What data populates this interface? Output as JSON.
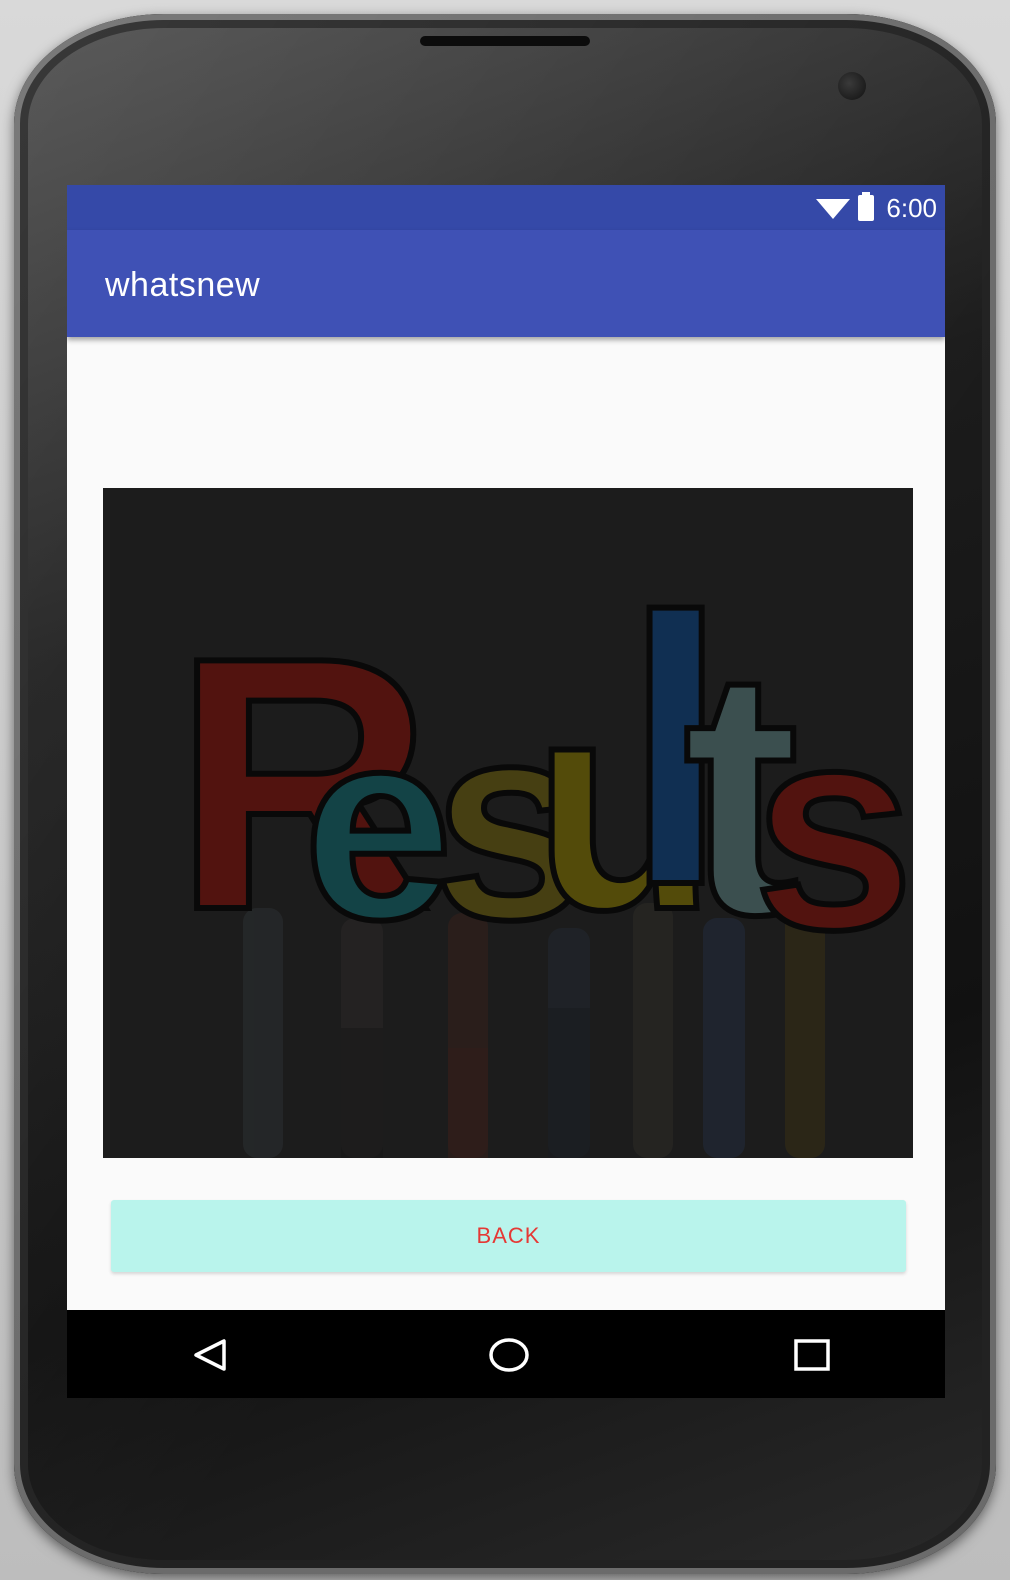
{
  "status_bar": {
    "time": "6:00",
    "icons": [
      "wifi-icon",
      "battery-icon"
    ]
  },
  "app_bar": {
    "title": "whatsnew"
  },
  "main": {
    "image": {
      "description_icon": "results-image",
      "text_in_image": "Results",
      "letter_colors": [
        "#8a1e16",
        "#1f6f74",
        "#7a6a1a",
        "#8a7a10",
        "#1d4f8a",
        "#6a8a8a",
        "#8a1e16"
      ]
    },
    "back_button": {
      "label": "BACK"
    }
  },
  "nav_bar": {
    "items": [
      "back-triangle-icon",
      "home-circle-icon",
      "recents-square-icon"
    ]
  },
  "colors": {
    "status_bar": "#3549a8",
    "app_bar": "#3f51b5",
    "button_bg": "#b9f4ec",
    "button_text": "#e53935",
    "screen_bg": "#fafafa"
  }
}
